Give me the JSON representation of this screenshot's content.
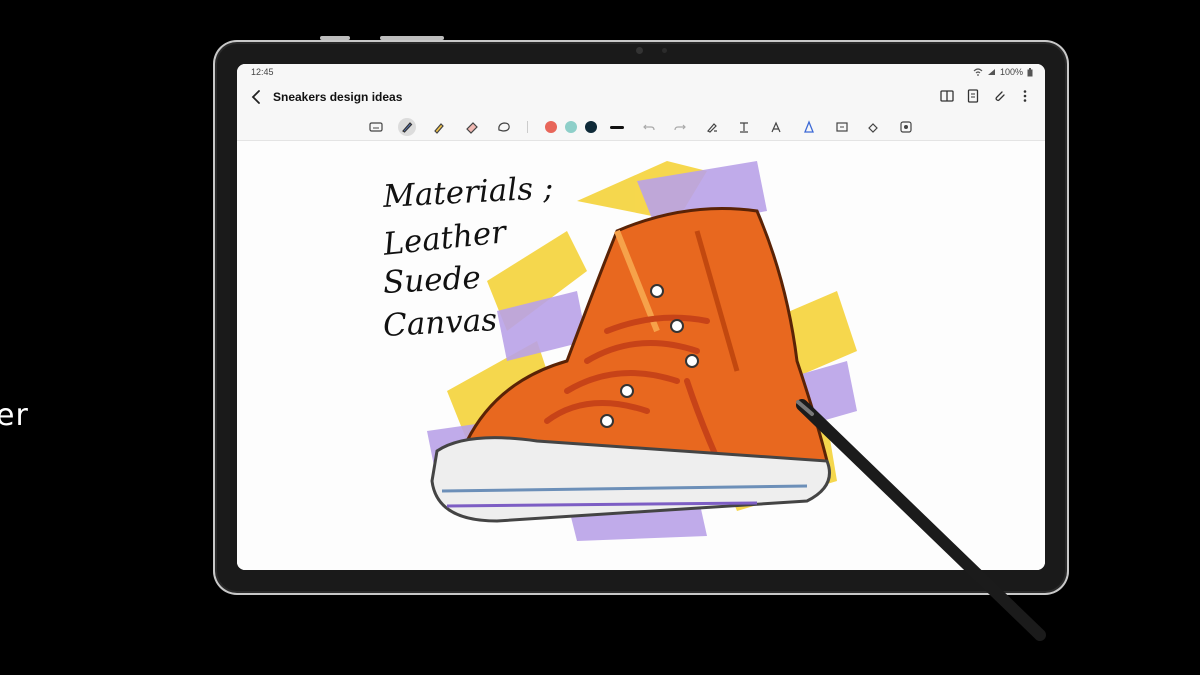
{
  "page": {
    "side_text": "er"
  },
  "status_bar": {
    "time": "12:45",
    "battery": "100%"
  },
  "app_bar": {
    "title": "Sneakers design ideas",
    "actions": [
      "book-icon",
      "page-icon",
      "attach-icon",
      "more-icon"
    ]
  },
  "toolbar": {
    "tools": [
      "keyboard-icon",
      "pen-icon",
      "highlighter-icon",
      "eraser-icon",
      "lasso-icon"
    ],
    "active_tool": "pen-icon",
    "colors": [
      "#e8665a",
      "#8ecfc9",
      "#0f2a38"
    ],
    "stroke": "thick",
    "secondary_tools": [
      "undo-icon",
      "redo-icon",
      "pen-settings-icon",
      "text-style-icon",
      "text-icon",
      "shape-icon",
      "image-icon",
      "fill-icon",
      "voice-icon"
    ]
  },
  "note": {
    "lines": [
      "Materials ;",
      "Leather",
      "Suede",
      "Canvas"
    ]
  },
  "colors": {
    "sneaker_orange": "#e8681f",
    "splash_yellow": "#f5d33a",
    "splash_purple": "#b9a2e8",
    "sole_white": "#eeeeee",
    "pen_black": "#1b1b1b"
  }
}
